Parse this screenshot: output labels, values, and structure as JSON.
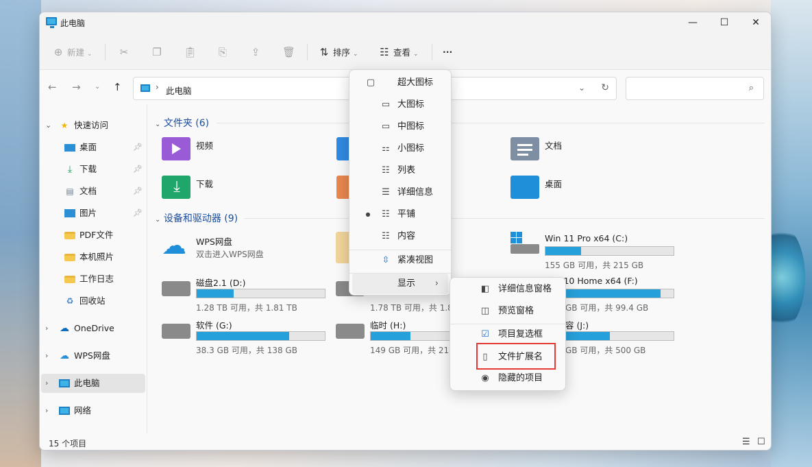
{
  "window": {
    "title": "此电脑",
    "minimize": "—",
    "maximize": "☐",
    "close": "✕"
  },
  "toolbar": {
    "new_label": "新建",
    "cut_icon": "scissors-icon",
    "copy_icon": "copy-icon",
    "paste_icon": "paste-icon",
    "rename_icon": "rename-icon",
    "share_icon": "share-icon",
    "delete_icon": "trash-icon",
    "sort_label": "排序",
    "view_label": "查看",
    "more_label": "···"
  },
  "address": {
    "path": "此电脑",
    "search_placeholder": ""
  },
  "sidebar": {
    "items": [
      {
        "label": "快速访问"
      },
      {
        "label": "桌面"
      },
      {
        "label": "下载"
      },
      {
        "label": "文档"
      },
      {
        "label": "图片"
      },
      {
        "label": "PDF文件"
      },
      {
        "label": "本机照片"
      },
      {
        "label": "工作日志"
      },
      {
        "label": "回收站"
      },
      {
        "label": "OneDrive"
      },
      {
        "label": "WPS网盘"
      },
      {
        "label": "此电脑"
      },
      {
        "label": "网络"
      }
    ]
  },
  "sections": {
    "folders": "文件夹 (6)",
    "drives": "设备和驱动器 (9)"
  },
  "folders": [
    {
      "name": "视频"
    },
    {
      "name": "下载"
    },
    {
      "name": "文档"
    },
    {
      "name": "桌面"
    }
  ],
  "drives": [
    {
      "name": "WPS网盘",
      "sub": "双击进入WPS网盘"
    },
    {
      "name": "Win 11 Pro x64 (C:)",
      "sub": "155 GB 可用，共 215 GB",
      "used": 0.28
    },
    {
      "name": "磁盘2.1 (D:)",
      "sub": "1.28 TB 可用，共 1.81 TB",
      "used": 0.29
    },
    {
      "name": "",
      "sub": "1.78 TB 可用，共 1.8",
      "used": 0.02
    },
    {
      "name": "Win 10 Home x64 (F:)",
      "sub": "GB 可用，共 99.4 GB",
      "used": 0.9
    },
    {
      "name": "软件 (G:)",
      "sub": "38.3 GB 可用，共 138 GB",
      "used": 0.72
    },
    {
      "name": "临时 (H:)",
      "sub": "149 GB 可用，共 215",
      "used": 0.31
    },
    {
      "name": "容 (J:)",
      "sub": "GB 可用，共 500 GB",
      "used": 0.6
    }
  ],
  "view_menu": {
    "items": [
      {
        "label": "超大图标"
      },
      {
        "label": "大图标"
      },
      {
        "label": "中图标"
      },
      {
        "label": "小图标"
      },
      {
        "label": "列表"
      },
      {
        "label": "详细信息"
      },
      {
        "label": "平铺"
      },
      {
        "label": "内容"
      },
      {
        "label": "紧凑视图"
      },
      {
        "label": "显示"
      }
    ]
  },
  "show_menu": {
    "items": [
      {
        "label": "详细信息窗格"
      },
      {
        "label": "预览窗格"
      },
      {
        "label": "项目复选框"
      },
      {
        "label": "文件扩展名"
      },
      {
        "label": "隐藏的项目"
      }
    ]
  },
  "status": {
    "count": "15 个项目"
  },
  "colors": {
    "accent": "#26a0da",
    "highlight_box": "#e53935",
    "section": "#1a4d9c"
  }
}
